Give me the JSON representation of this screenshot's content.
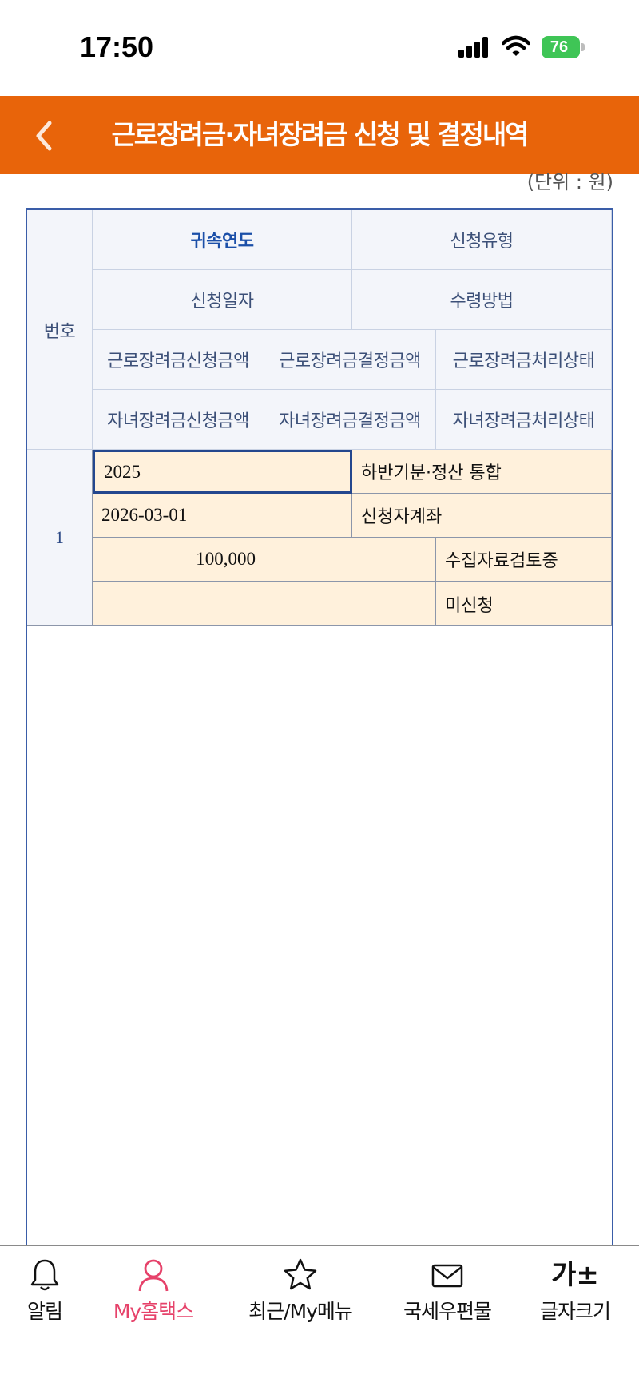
{
  "status_bar": {
    "time": "17:50",
    "battery": "76"
  },
  "header": {
    "title": "근로장려금·자녀장려금 신청 및 결정내역"
  },
  "unit_label": "(단위 : 원)",
  "table": {
    "headers": {
      "number": "번호",
      "row1": [
        "귀속연도",
        "신청유형"
      ],
      "row2": [
        "신청일자",
        "수령방법"
      ],
      "row3": [
        "근로장려금신청금액",
        "근로장려금결정금액",
        "근로장려금처리상태"
      ],
      "row4": [
        "자녀장려금신청금액",
        "자녀장려금결정금액",
        "자녀장려금처리상태"
      ]
    },
    "rows": [
      {
        "number": "1",
        "year": "2025",
        "type": "하반기분·정산 통합",
        "date": "2026-03-01",
        "method": "신청자계좌",
        "earned_request": "100,000",
        "earned_decided": "",
        "earned_status": "수집자료검토중",
        "child_request": "",
        "child_decided": "",
        "child_status": "미신청"
      }
    ]
  },
  "bottom_nav": [
    {
      "label": "알림",
      "icon": "bell-icon"
    },
    {
      "label": "My홈택스",
      "icon": "person-icon",
      "active": true
    },
    {
      "label": "최근/My메뉴",
      "icon": "star-icon"
    },
    {
      "label": "국세우편물",
      "icon": "mail-icon"
    },
    {
      "label": "글자크기",
      "icon": "font-size-icon",
      "glyph": "가±"
    }
  ],
  "colors": {
    "header": "#e8640a",
    "active_nav": "#e6426a",
    "table_border": "#3a5da8",
    "data_bg": "#fff1dc"
  }
}
